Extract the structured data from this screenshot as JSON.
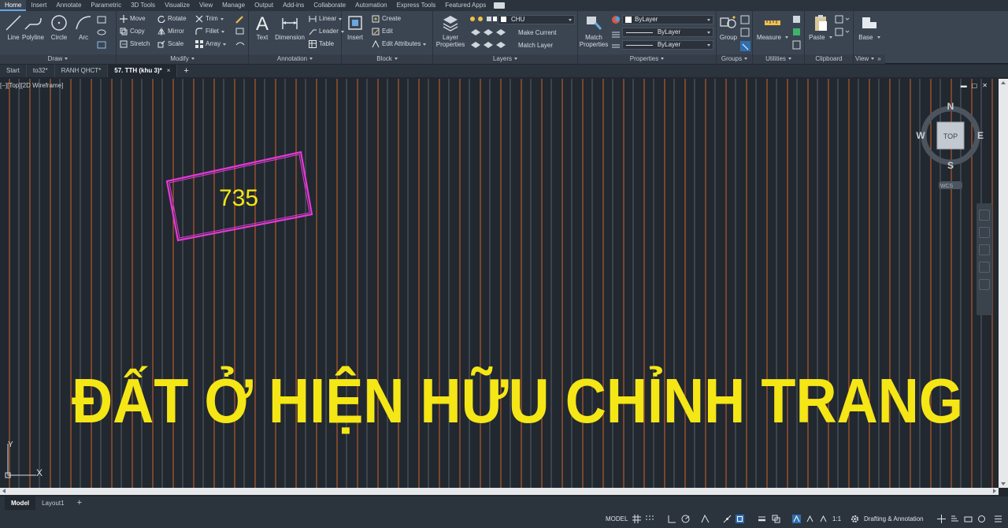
{
  "ribbon": {
    "tabs": [
      "Home",
      "Insert",
      "Annotate",
      "Parametric",
      "3D Tools",
      "Visualize",
      "View",
      "Manage",
      "Output",
      "Add-ins",
      "Collaborate",
      "Automation",
      "Express Tools",
      "Featured Apps"
    ],
    "active_tab": "Home",
    "draw": {
      "title": "Draw",
      "line": "Line",
      "polyline": "Polyline",
      "circle": "Circle",
      "arc": "Arc"
    },
    "modify": {
      "title": "Modify",
      "move": "Move",
      "rotate": "Rotate",
      "trim": "Trim",
      "copy": "Copy",
      "mirror": "Mirror",
      "fillet": "Fillet",
      "stretch": "Stretch",
      "scale": "Scale",
      "array": "Array"
    },
    "annotation": {
      "title": "Annotation",
      "text": "Text",
      "dimension": "Dimension",
      "linear": "Linear",
      "leader": "Leader",
      "table": "Table"
    },
    "block": {
      "title": "Block",
      "insert": "Insert",
      "create": "Create",
      "edit": "Edit",
      "edit_attributes": "Edit Attributes"
    },
    "layers": {
      "title": "Layers",
      "layer_properties_1": "Layer",
      "layer_properties_2": "Properties",
      "current_layer": "CHU",
      "make_current": "Make Current",
      "match_layer": "Match Layer"
    },
    "properties": {
      "title": "Properties",
      "match_1": "Match",
      "match_2": "Properties",
      "color": "ByLayer",
      "linetype": "ByLayer",
      "lineweight": "ByLayer"
    },
    "groups": {
      "title": "Groups",
      "group": "Group"
    },
    "utilities": {
      "title": "Utilities",
      "measure": "Measure"
    },
    "clipboard": {
      "title": "Clipboard",
      "paste": "Paste"
    },
    "view": {
      "title": "View",
      "base": "Base"
    }
  },
  "file_tabs": [
    {
      "label": "Start",
      "active": false
    },
    {
      "label": "to32*",
      "active": false
    },
    {
      "label": "RANH QHCT*",
      "active": false
    },
    {
      "label": "57. TTH (khu 3)*",
      "active": true
    }
  ],
  "file_tab_close": "×",
  "file_tab_add": "+",
  "viewport": {
    "label": "[−][Top][2D Wireframe]",
    "win_minimize": "▬",
    "win_restore": "▢",
    "win_close": "✕"
  },
  "drawing": {
    "parcel_number": "735",
    "land_use_text": "ĐẤT Ở HIỆN HỮU CHỈNH TRANG",
    "text_color": "#f5e616",
    "parcel_color": "#e838d8",
    "line_color_orange": "#e56a2a",
    "line_color_gray": "#8a9096",
    "ucs_x": "X",
    "ucs_y": "Y"
  },
  "viewcube": {
    "north": "N",
    "south": "S",
    "east": "E",
    "west": "W",
    "face": "TOP",
    "wcs": "WCS"
  },
  "layout_tabs": [
    {
      "label": "Model",
      "active": true
    },
    {
      "label": "Layout1",
      "active": false
    }
  ],
  "layout_add": "+",
  "status": {
    "model": "MODEL",
    "scale": "1:1",
    "workspace": "Drafting & Annotation"
  }
}
